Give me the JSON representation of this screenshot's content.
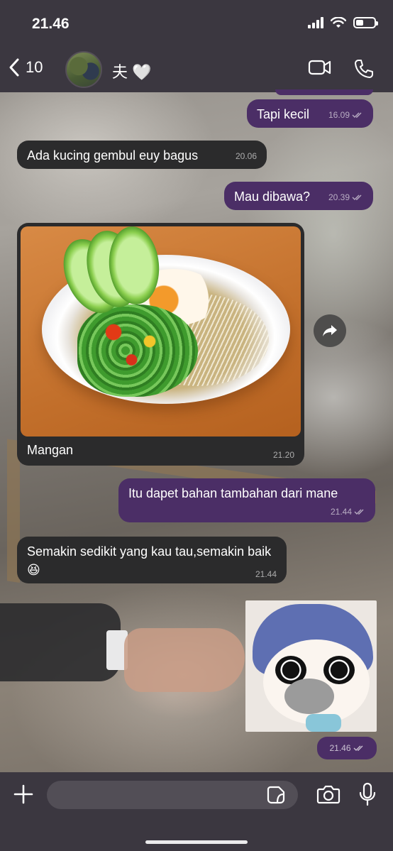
{
  "status_bar": {
    "time": "21.46"
  },
  "header": {
    "back_count": "10",
    "contact_name": "夫 🤍"
  },
  "messages": [
    {
      "direction": "out",
      "text": "Tapi kecil",
      "time": "16.09"
    },
    {
      "direction": "in",
      "text": "Ada kucing gembul euy bagus",
      "time": "20.06"
    },
    {
      "direction": "out",
      "text": "Mau dibawa?",
      "time": "20.39"
    },
    {
      "direction": "in",
      "type": "photo",
      "caption": "Mangan",
      "time": "21.20"
    },
    {
      "direction": "out",
      "text": "Itu dapet bahan tambahan dari mane",
      "time": "21.44"
    },
    {
      "direction": "in",
      "text": "Semakin sedikit yang kau tau,semakin baik😆",
      "time": "21.44"
    },
    {
      "direction": "out",
      "type": "sticker",
      "time": "21.46"
    }
  ],
  "composer": {
    "placeholder": ""
  },
  "colors": {
    "outgoing_bubble": "#4b2e66",
    "incoming_bubble": "#2b2b2c",
    "bar_background": "#3b3740"
  },
  "icons": [
    "back-chevron-icon",
    "video-call-icon",
    "voice-call-icon",
    "forward-icon",
    "plus-icon",
    "sticker-icon",
    "camera-icon",
    "microphone-icon",
    "read-ticks-icon"
  ]
}
